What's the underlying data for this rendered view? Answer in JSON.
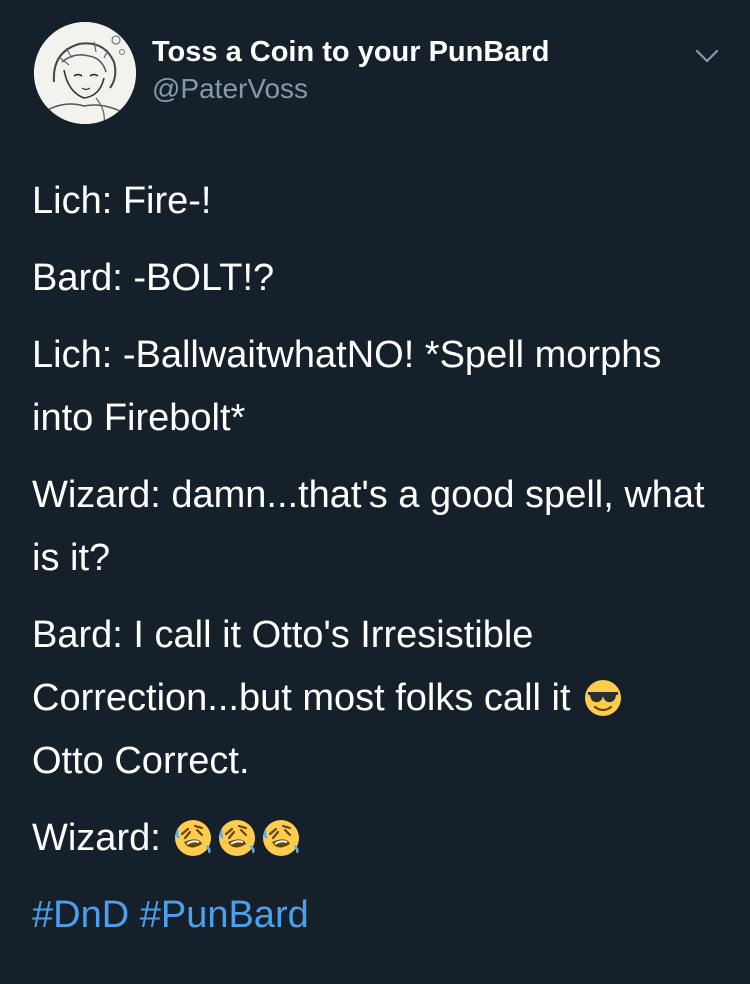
{
  "author": {
    "display_name": "Toss a Coin to your PunBard",
    "handle": "@PaterVoss",
    "avatar_icon": "anime-sketch-avatar"
  },
  "menu_icon": "chevron-down-icon",
  "tweet": {
    "lines": [
      "Lich: Fire-!",
      "Bard: -BOLT!?",
      "Lich: -BallwaitwhatNO! *Spell morphs into Firebolt*",
      "Wizard: damn...that's a good spell, what is it?"
    ],
    "bard_line_before_emoji": "Bard: I call it Otto's Irresistible Correction...but most folks call it",
    "bard_line_after_emoji": "Otto Correct.",
    "wizard_label": "Wizard:",
    "emoji_sunglasses": "smiling-face-with-sunglasses-icon",
    "emoji_laughing": "rolling-on-floor-laughing-icon",
    "laughing_count": 3,
    "hashtags": [
      "#DnD",
      "#PunBard"
    ]
  },
  "colors": {
    "background": "#15202b",
    "text": "#ffffff",
    "secondary": "#8899a6",
    "link": "#4aa0ec",
    "emoji_yellow": "#ffcc4d"
  }
}
